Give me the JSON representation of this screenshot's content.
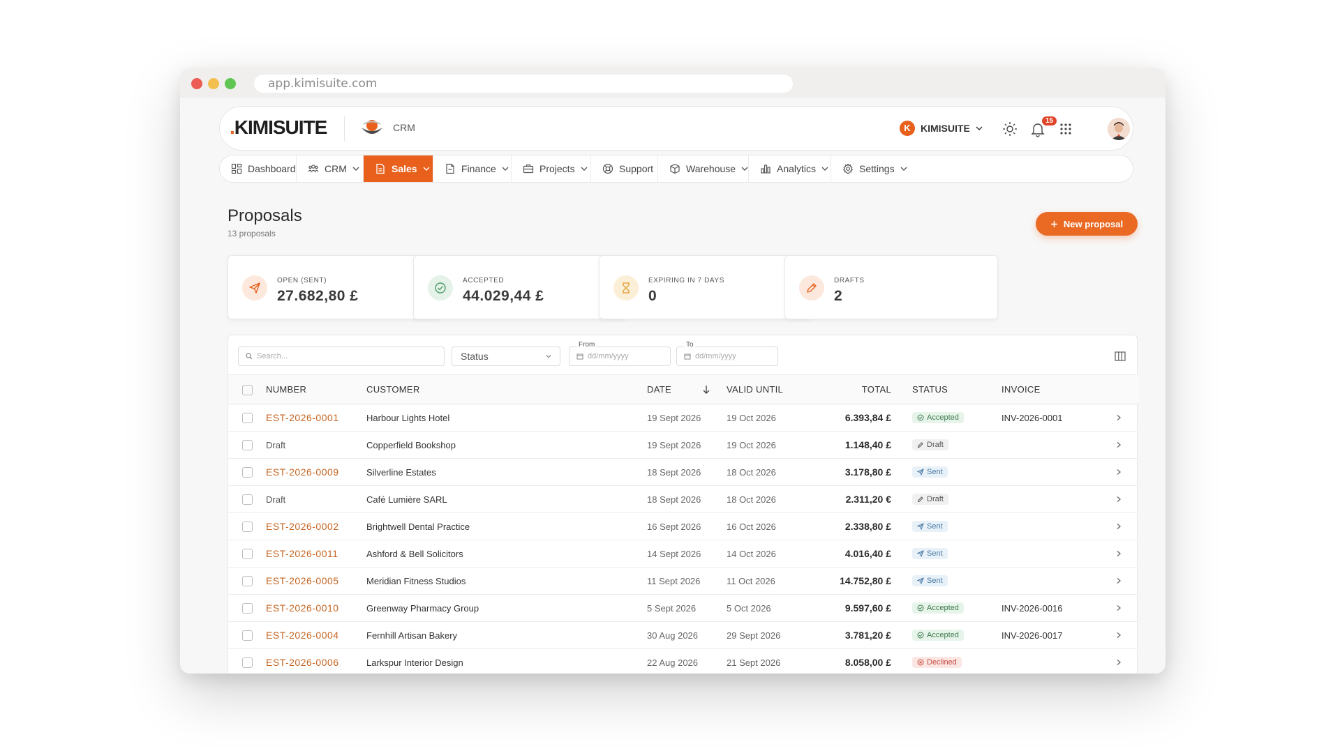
{
  "browser": {
    "url": "app.kimisuite.com"
  },
  "header": {
    "logo_lead": ".",
    "logo_text": "KIMISUITE",
    "module_label": "CRM",
    "company_initial": "K",
    "company_name": "KIMISUITE",
    "notification_count": "15"
  },
  "nav": {
    "items": [
      {
        "label": "Dashboard",
        "icon": "dashboard-icon"
      },
      {
        "label": "CRM",
        "icon": "users-icon"
      },
      {
        "label": "Sales",
        "icon": "document-icon"
      },
      {
        "label": "Finance",
        "icon": "file-icon"
      },
      {
        "label": "Projects",
        "icon": "briefcase-icon"
      },
      {
        "label": "Support",
        "icon": "lifebuoy-icon"
      },
      {
        "label": "Warehouse",
        "icon": "box-icon"
      },
      {
        "label": "Analytics",
        "icon": "bar-chart-icon"
      },
      {
        "label": "Settings",
        "icon": "gear-icon"
      }
    ],
    "active": "Sales"
  },
  "page": {
    "title": "Proposals",
    "subtitle": "13 proposals",
    "new_button": "New proposal"
  },
  "kpis": [
    {
      "label": "OPEN (SENT)",
      "value": "27.682,80 £",
      "icon": "send-icon",
      "color": "#e8601c"
    },
    {
      "label": "ACCEPTED",
      "value": "44.029,44 £",
      "icon": "check-circle-icon",
      "color": "#4c9a67"
    },
    {
      "label": "EXPIRING IN 7 DAYS",
      "value": "0",
      "icon": "hourglass-icon",
      "color": "#e0a43a"
    },
    {
      "label": "DRAFTS",
      "value": "2",
      "icon": "pencil-icon",
      "color": "#e8601c"
    }
  ],
  "filters": {
    "search_placeholder": "Search...",
    "status_label": "Status",
    "from_label": "From",
    "to_label": "To",
    "date_placeholder": "dd/mm/yyyy"
  },
  "table": {
    "columns": [
      "NUMBER",
      "CUSTOMER",
      "DATE",
      "VALID UNTIL",
      "TOTAL",
      "STATUS",
      "INVOICE"
    ],
    "rows": [
      {
        "number": "EST-2026-0001",
        "is_draft": false,
        "customer": "Harbour Lights Hotel",
        "date": "19 Sept 2026",
        "valid": "19 Oct 2026",
        "total": "6.393,84 £",
        "status": "Accepted",
        "invoice": "INV-2026-0001"
      },
      {
        "number": "Draft",
        "is_draft": true,
        "customer": "Copperfield Bookshop",
        "date": "19 Sept 2026",
        "valid": "19 Oct 2026",
        "total": "1.148,40 £",
        "status": "Draft",
        "invoice": ""
      },
      {
        "number": "EST-2026-0009",
        "is_draft": false,
        "customer": "Silverline Estates",
        "date": "18 Sept 2026",
        "valid": "18 Oct 2026",
        "total": "3.178,80 £",
        "status": "Sent",
        "invoice": ""
      },
      {
        "number": "Draft",
        "is_draft": true,
        "customer": "Café Lumière SARL",
        "date": "18 Sept 2026",
        "valid": "18 Oct 2026",
        "total": "2.311,20 €",
        "status": "Draft",
        "invoice": ""
      },
      {
        "number": "EST-2026-0002",
        "is_draft": false,
        "customer": "Brightwell Dental Practice",
        "date": "16 Sept 2026",
        "valid": "16 Oct 2026",
        "total": "2.338,80 £",
        "status": "Sent",
        "invoice": ""
      },
      {
        "number": "EST-2026-0011",
        "is_draft": false,
        "customer": "Ashford & Bell Solicitors",
        "date": "14 Sept 2026",
        "valid": "14 Oct 2026",
        "total": "4.016,40 £",
        "status": "Sent",
        "invoice": ""
      },
      {
        "number": "EST-2026-0005",
        "is_draft": false,
        "customer": "Meridian Fitness Studios",
        "date": "11 Sept 2026",
        "valid": "11 Oct 2026",
        "total": "14.752,80 £",
        "status": "Sent",
        "invoice": ""
      },
      {
        "number": "EST-2026-0010",
        "is_draft": false,
        "customer": "Greenway Pharmacy Group",
        "date": "5 Sept 2026",
        "valid": "5 Oct 2026",
        "total": "9.597,60 £",
        "status": "Accepted",
        "invoice": "INV-2026-0016"
      },
      {
        "number": "EST-2026-0004",
        "is_draft": false,
        "customer": "Fernhill Artisan Bakery",
        "date": "30 Aug 2026",
        "valid": "29 Sept 2026",
        "total": "3.781,20 £",
        "status": "Accepted",
        "invoice": "INV-2026-0017"
      },
      {
        "number": "EST-2026-0006",
        "is_draft": false,
        "customer": "Larkspur Interior Design",
        "date": "22 Aug 2026",
        "valid": "21 Sept 2026",
        "total": "8.058,00 £",
        "status": "Declined",
        "invoice": ""
      }
    ]
  },
  "status_colors": {
    "Accepted": "#3f7a4f",
    "Draft": "#555555",
    "Sent": "#4a7aa6",
    "Declined": "#c6473a"
  },
  "accent_color": "#e8601c"
}
